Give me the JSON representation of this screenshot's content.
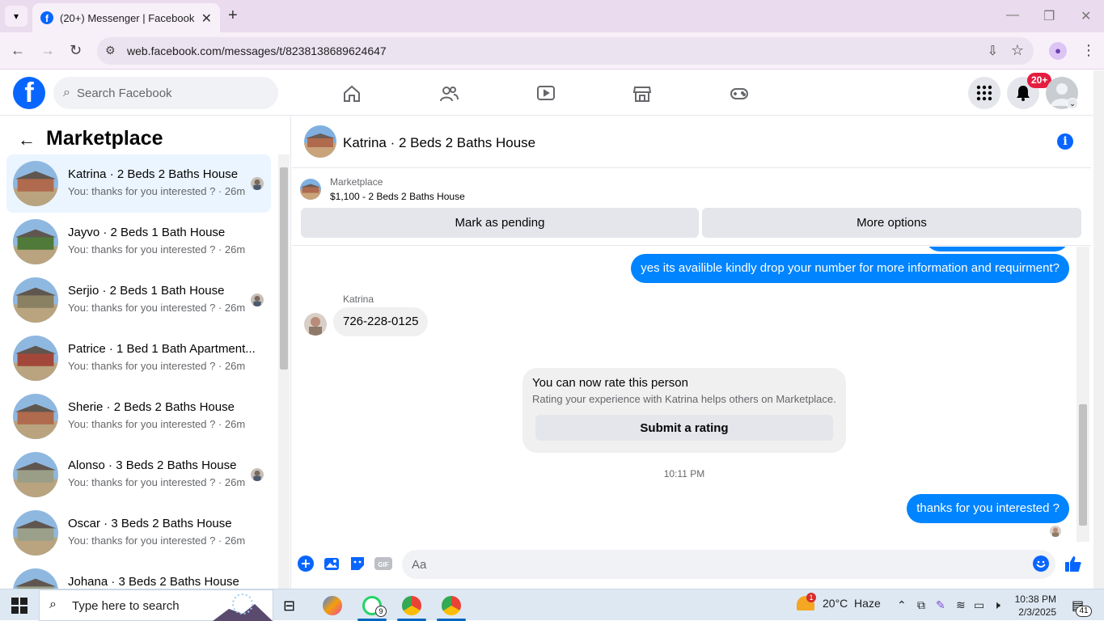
{
  "browser": {
    "tab_title": "(20+) Messenger | Facebook",
    "url": "web.facebook.com/messages/t/8238138689624647"
  },
  "fb": {
    "search_placeholder": "Search Facebook",
    "notification_badge": "20+"
  },
  "sidebar": {
    "title": "Marketplace",
    "conversations": [
      {
        "name": "Katrina · 2 Beds 2 Baths House",
        "snippet": "You: thanks for you interested ? · 26m",
        "active": true,
        "thumb_color": "#b06a4e",
        "seen": true
      },
      {
        "name": "Jayvo · 2 Beds 1 Bath House",
        "snippet": "You: thanks for you interested ? · 26m",
        "active": false,
        "thumb_color": "#4f7a3a",
        "seen": false
      },
      {
        "name": "Serjio · 2 Beds 1 Bath House",
        "snippet": "You: thanks for you interested ? · 26m",
        "active": false,
        "thumb_color": "#8a8062",
        "seen": true
      },
      {
        "name": "Patrice · 1 Bed 1 Bath Apartment...",
        "snippet": "You: thanks for you interested ? · 26m",
        "active": false,
        "thumb_color": "#a2483a",
        "seen": false
      },
      {
        "name": "Sherie · 2 Beds 2 Baths House",
        "snippet": "You: thanks for you interested ? · 26m",
        "active": false,
        "thumb_color": "#b06a4e",
        "seen": false
      },
      {
        "name": "Alonso · 3 Beds 2 Baths House",
        "snippet": "You: thanks for you interested ? · 26m",
        "active": false,
        "thumb_color": "#9a9e86",
        "seen": true
      },
      {
        "name": "Oscar · 3 Beds 2 Baths House",
        "snippet": "You: thanks for you interested ? · 26m",
        "active": false,
        "thumb_color": "#9aa08a",
        "seen": false
      },
      {
        "name": "Johana · 3 Beds 2 Baths House",
        "snippet": "",
        "active": false,
        "thumb_color": "#9aa08a",
        "seen": false
      }
    ]
  },
  "chat": {
    "title": "Katrina · 2 Beds 2 Baths House",
    "listing_source": "Marketplace",
    "listing_price": "$1,100 - 2 Beds 2 Baths House",
    "mark_pending_label": "Mark as pending",
    "more_options_label": "More options",
    "message_out_1": "yes its availible kindly drop your number for more information and requirment?",
    "sender_name": "Katrina",
    "message_in_1": "726-228-0125",
    "rate_title": "You can now rate this person",
    "rate_subtitle": "Rating your experience with Katrina helps others on Marketplace.",
    "rate_button": "Submit a rating",
    "timestamp": "10:11 PM",
    "message_out_2": "thanks for you interested ?",
    "composer_placeholder": "Aa"
  },
  "taskbar": {
    "search_label": "Type here to search",
    "whatsapp_count": "9",
    "weather_alert": "1",
    "weather": "20°C  Haze",
    "time": "10:38 PM",
    "date": "2/3/2025",
    "notification_count": "41"
  },
  "colors": {
    "accent": "#0866ff",
    "bubble_out": "#0084ff",
    "active_row": "#ebf5ff",
    "badge_red": "#e41e3f"
  }
}
